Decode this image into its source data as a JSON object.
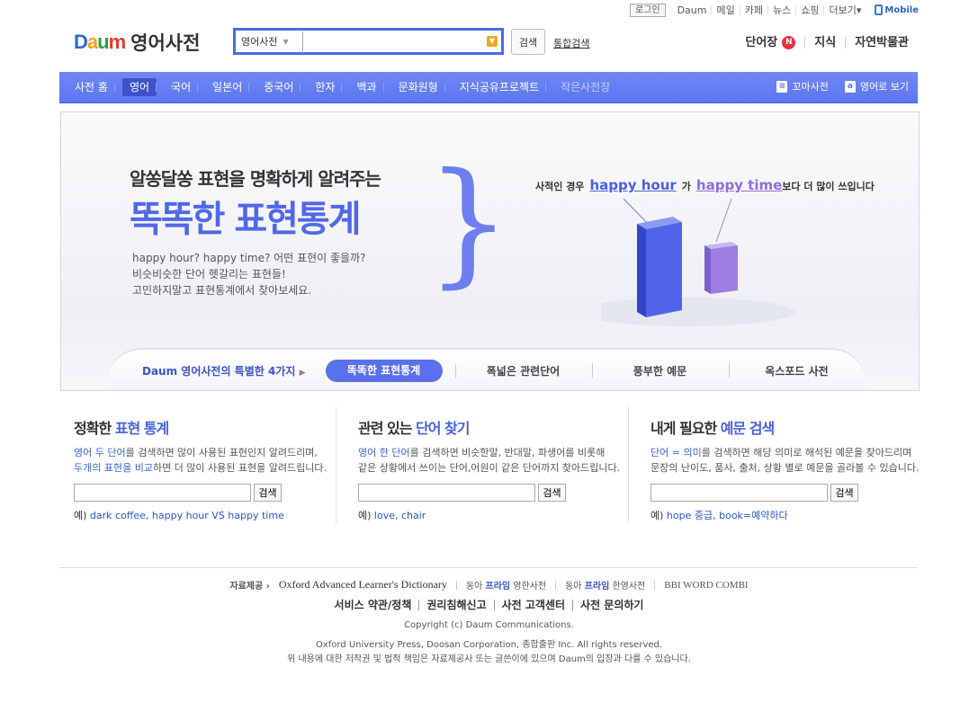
{
  "util": {
    "login": "로그인",
    "links": [
      "Daum",
      "메일",
      "카페",
      "뉴스",
      "쇼핑",
      "더보기"
    ],
    "more_arrow": "▾",
    "mobile": "Mobile"
  },
  "header": {
    "logo_daum": "Daum",
    "logo_title": "영어사전",
    "search_select": "영어사전",
    "search_button": "검색",
    "unified_search": "통합검색",
    "right_links": [
      "단어장",
      "지식",
      "자연박물관"
    ],
    "badge": "N"
  },
  "nav": {
    "items": [
      "사전 홈",
      "영어",
      "국어",
      "일본어",
      "중국어",
      "한자",
      "백과",
      "문화원형",
      "지식공유프로젝트",
      "작은사전장"
    ],
    "right": [
      "꼬마사전",
      "영어로 보기"
    ]
  },
  "banner": {
    "line1": "알쏭달쏭 표현을 명확하게 알려주는",
    "line2": "똑똑한 표현통계",
    "desc": [
      "happy hour? happy time? 어떤 표현이 좋을까?",
      "비슷비슷한 단어 헷갈리는 표현들!",
      "고민하지말고 표현통계에서 찾아보세요."
    ],
    "caption_pre": "사적인 경우",
    "term1": "happy hour",
    "mid": "가",
    "term2": "happy time",
    "caption_post": "보다 더 많이 쓰입니다",
    "intro": "Daum 영어사전의 특별한 4가지",
    "tabs": [
      "똑똑한 표현통계",
      "폭넓은 관련단어",
      "풍부한 예문",
      "옥스포드 사전"
    ]
  },
  "features": [
    {
      "title_pre": "정확한 ",
      "title_hl": "표현 통계",
      "desc1_hl": "영어 두 단어",
      "desc1": "를 검색하면 많이 사용된 표현인지 알려드리며,",
      "desc2_hl": "두개의 표현을 비교",
      "desc2": "하면 더 많이 사용된 표현을 알려드립니다.",
      "button": "검색",
      "example_label": "예)",
      "example": "dark coffee, happy hour VS happy time"
    },
    {
      "title_pre": "관련 있는 ",
      "title_hl": "단어 찾기",
      "desc1_hl": "영어 한 단어",
      "desc1": "를 검색하면 비슷한말, 반대말, 파생어를 비롯해",
      "desc2_hl": "",
      "desc2": "같은 상황에서 쓰이는 단어,어원이 같은 단어까지 찾아드립니다.",
      "button": "검색",
      "example_label": "예)",
      "example": "love, chair"
    },
    {
      "title_pre": "내게 필요한 ",
      "title_hl": "예문 검색",
      "desc1_hl": "단어 = 의미",
      "desc1": "를 검색하면 해당 의미로 해석된 예문을 찾아드리며",
      "desc2_hl": "",
      "desc2": "문장의 난이도, 품사, 출처, 상황 별로 예문을 골라볼 수 있습니다.",
      "button": "검색",
      "example_label": "예)",
      "example": "hope 중급, book=예약하다"
    }
  ],
  "footer": {
    "source_label": "자료제공",
    "oxford": "Oxford Advanced Learner's Dictionary",
    "donga1_a": "동아 ",
    "donga1_b": "프라임",
    "donga1_c": " 영한사전",
    "donga2_a": "동아 ",
    "donga2_b": "프라임",
    "donga2_c": " 한영사전",
    "bbi": "BBI WORD COMBI",
    "policy": [
      "서비스 약관/정책",
      "권리침해신고",
      "사전 고객센터",
      "사전 문의하기"
    ],
    "copy1": "Copyright (c) Daum Communications.",
    "copy2": "Oxford University Press, Doosan Corporation, 종합출판 Inc. All rights reserved.",
    "copy3": "위 내용에 대한 저작권 및 법적 책임은 자료제공사 또는 글쓴이에 있으며 Daum의 입장과 다를 수 있습니다."
  },
  "colors": {
    "nav": "#5c76ee",
    "accent": "#4a61de",
    "bar1": "#5064e8",
    "bar2": "#9b7ee0"
  }
}
